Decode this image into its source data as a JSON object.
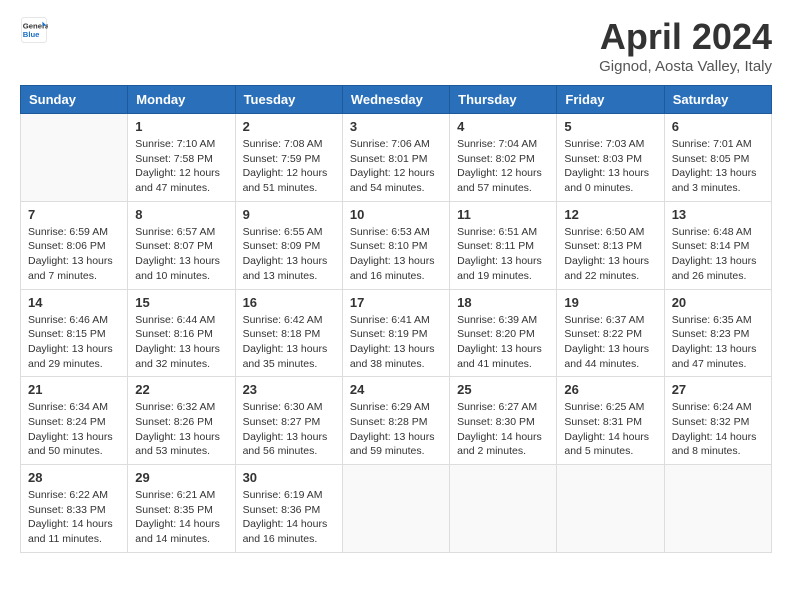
{
  "header": {
    "logo_general": "General",
    "logo_blue": "Blue",
    "month_title": "April 2024",
    "location": "Gignod, Aosta Valley, Italy"
  },
  "calendar": {
    "weekdays": [
      "Sunday",
      "Monday",
      "Tuesday",
      "Wednesday",
      "Thursday",
      "Friday",
      "Saturday"
    ],
    "weeks": [
      [
        {
          "day": "",
          "info": ""
        },
        {
          "day": "1",
          "info": "Sunrise: 7:10 AM\nSunset: 7:58 PM\nDaylight: 12 hours and 47 minutes."
        },
        {
          "day": "2",
          "info": "Sunrise: 7:08 AM\nSunset: 7:59 PM\nDaylight: 12 hours and 51 minutes."
        },
        {
          "day": "3",
          "info": "Sunrise: 7:06 AM\nSunset: 8:01 PM\nDaylight: 12 hours and 54 minutes."
        },
        {
          "day": "4",
          "info": "Sunrise: 7:04 AM\nSunset: 8:02 PM\nDaylight: 12 hours and 57 minutes."
        },
        {
          "day": "5",
          "info": "Sunrise: 7:03 AM\nSunset: 8:03 PM\nDaylight: 13 hours and 0 minutes."
        },
        {
          "day": "6",
          "info": "Sunrise: 7:01 AM\nSunset: 8:05 PM\nDaylight: 13 hours and 3 minutes."
        }
      ],
      [
        {
          "day": "7",
          "info": "Sunrise: 6:59 AM\nSunset: 8:06 PM\nDaylight: 13 hours and 7 minutes."
        },
        {
          "day": "8",
          "info": "Sunrise: 6:57 AM\nSunset: 8:07 PM\nDaylight: 13 hours and 10 minutes."
        },
        {
          "day": "9",
          "info": "Sunrise: 6:55 AM\nSunset: 8:09 PM\nDaylight: 13 hours and 13 minutes."
        },
        {
          "day": "10",
          "info": "Sunrise: 6:53 AM\nSunset: 8:10 PM\nDaylight: 13 hours and 16 minutes."
        },
        {
          "day": "11",
          "info": "Sunrise: 6:51 AM\nSunset: 8:11 PM\nDaylight: 13 hours and 19 minutes."
        },
        {
          "day": "12",
          "info": "Sunrise: 6:50 AM\nSunset: 8:13 PM\nDaylight: 13 hours and 22 minutes."
        },
        {
          "day": "13",
          "info": "Sunrise: 6:48 AM\nSunset: 8:14 PM\nDaylight: 13 hours and 26 minutes."
        }
      ],
      [
        {
          "day": "14",
          "info": "Sunrise: 6:46 AM\nSunset: 8:15 PM\nDaylight: 13 hours and 29 minutes."
        },
        {
          "day": "15",
          "info": "Sunrise: 6:44 AM\nSunset: 8:16 PM\nDaylight: 13 hours and 32 minutes."
        },
        {
          "day": "16",
          "info": "Sunrise: 6:42 AM\nSunset: 8:18 PM\nDaylight: 13 hours and 35 minutes."
        },
        {
          "day": "17",
          "info": "Sunrise: 6:41 AM\nSunset: 8:19 PM\nDaylight: 13 hours and 38 minutes."
        },
        {
          "day": "18",
          "info": "Sunrise: 6:39 AM\nSunset: 8:20 PM\nDaylight: 13 hours and 41 minutes."
        },
        {
          "day": "19",
          "info": "Sunrise: 6:37 AM\nSunset: 8:22 PM\nDaylight: 13 hours and 44 minutes."
        },
        {
          "day": "20",
          "info": "Sunrise: 6:35 AM\nSunset: 8:23 PM\nDaylight: 13 hours and 47 minutes."
        }
      ],
      [
        {
          "day": "21",
          "info": "Sunrise: 6:34 AM\nSunset: 8:24 PM\nDaylight: 13 hours and 50 minutes."
        },
        {
          "day": "22",
          "info": "Sunrise: 6:32 AM\nSunset: 8:26 PM\nDaylight: 13 hours and 53 minutes."
        },
        {
          "day": "23",
          "info": "Sunrise: 6:30 AM\nSunset: 8:27 PM\nDaylight: 13 hours and 56 minutes."
        },
        {
          "day": "24",
          "info": "Sunrise: 6:29 AM\nSunset: 8:28 PM\nDaylight: 13 hours and 59 minutes."
        },
        {
          "day": "25",
          "info": "Sunrise: 6:27 AM\nSunset: 8:30 PM\nDaylight: 14 hours and 2 minutes."
        },
        {
          "day": "26",
          "info": "Sunrise: 6:25 AM\nSunset: 8:31 PM\nDaylight: 14 hours and 5 minutes."
        },
        {
          "day": "27",
          "info": "Sunrise: 6:24 AM\nSunset: 8:32 PM\nDaylight: 14 hours and 8 minutes."
        }
      ],
      [
        {
          "day": "28",
          "info": "Sunrise: 6:22 AM\nSunset: 8:33 PM\nDaylight: 14 hours and 11 minutes."
        },
        {
          "day": "29",
          "info": "Sunrise: 6:21 AM\nSunset: 8:35 PM\nDaylight: 14 hours and 14 minutes."
        },
        {
          "day": "30",
          "info": "Sunrise: 6:19 AM\nSunset: 8:36 PM\nDaylight: 14 hours and 16 minutes."
        },
        {
          "day": "",
          "info": ""
        },
        {
          "day": "",
          "info": ""
        },
        {
          "day": "",
          "info": ""
        },
        {
          "day": "",
          "info": ""
        }
      ]
    ]
  }
}
